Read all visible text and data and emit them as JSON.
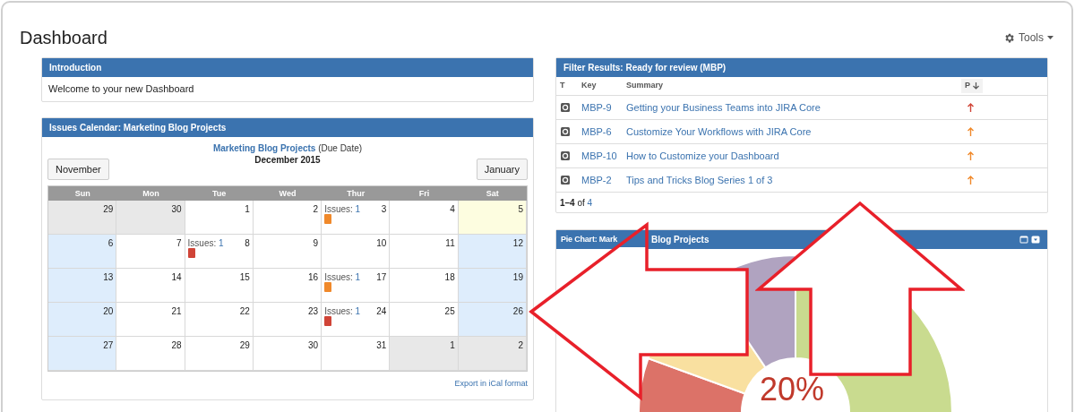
{
  "page": {
    "title": "Dashboard",
    "tools": "Tools"
  },
  "introduction": {
    "title": "Introduction",
    "text": "Welcome to your new Dashboard"
  },
  "calendar": {
    "title": "Issues Calendar: Marketing Blog Projects",
    "project": "Marketing Blog Projects",
    "field": "(Due Date)",
    "month": "December 2015",
    "prev": "November",
    "next": "January",
    "weekdays": [
      "Sun",
      "Mon",
      "Tue",
      "Wed",
      "Thur",
      "Fri",
      "Sat"
    ],
    "weeks": [
      [
        {
          "day": "29",
          "kind": "other"
        },
        {
          "day": "30",
          "kind": "other"
        },
        {
          "day": "1",
          "kind": "normal"
        },
        {
          "day": "2",
          "kind": "normal"
        },
        {
          "day": "3",
          "kind": "normal",
          "issues": {
            "label": "Issues:",
            "count": "1",
            "color": "#f0892b"
          }
        },
        {
          "day": "4",
          "kind": "normal"
        },
        {
          "day": "5",
          "kind": "today"
        }
      ],
      [
        {
          "day": "6",
          "kind": "weekend"
        },
        {
          "day": "7",
          "kind": "normal"
        },
        {
          "day": "8",
          "kind": "normal",
          "issues": {
            "label": "Issues:",
            "count": "1",
            "color": "#d04437"
          }
        },
        {
          "day": "9",
          "kind": "normal"
        },
        {
          "day": "10",
          "kind": "normal"
        },
        {
          "day": "11",
          "kind": "normal"
        },
        {
          "day": "12",
          "kind": "weekend"
        }
      ],
      [
        {
          "day": "13",
          "kind": "weekend"
        },
        {
          "day": "14",
          "kind": "normal"
        },
        {
          "day": "15",
          "kind": "normal"
        },
        {
          "day": "16",
          "kind": "normal"
        },
        {
          "day": "17",
          "kind": "normal",
          "issues": {
            "label": "Issues:",
            "count": "1",
            "color": "#f0892b"
          }
        },
        {
          "day": "18",
          "kind": "normal"
        },
        {
          "day": "19",
          "kind": "weekend"
        }
      ],
      [
        {
          "day": "20",
          "kind": "weekend"
        },
        {
          "day": "21",
          "kind": "normal"
        },
        {
          "day": "22",
          "kind": "normal"
        },
        {
          "day": "23",
          "kind": "normal"
        },
        {
          "day": "24",
          "kind": "normal",
          "issues": {
            "label": "Issues:",
            "count": "1",
            "color": "#d04437"
          }
        },
        {
          "day": "25",
          "kind": "normal"
        },
        {
          "day": "26",
          "kind": "weekend"
        }
      ],
      [
        {
          "day": "27",
          "kind": "weekend"
        },
        {
          "day": "28",
          "kind": "normal"
        },
        {
          "day": "29",
          "kind": "normal"
        },
        {
          "day": "30",
          "kind": "normal"
        },
        {
          "day": "31",
          "kind": "normal"
        },
        {
          "day": "1",
          "kind": "other"
        },
        {
          "day": "2",
          "kind": "other"
        }
      ]
    ],
    "export": "Export in iCal format"
  },
  "filter": {
    "title": "Filter Results: Ready for review (MBP)",
    "columns": [
      "T",
      "Key",
      "Summary",
      "P"
    ],
    "rows": [
      {
        "key": "MBP-9",
        "summary": "Getting your Business Teams into JIRA Core",
        "color": "#d04437"
      },
      {
        "key": "MBP-6",
        "summary": "Customize Your Workflows with JIRA Core",
        "color": "#f0892b"
      },
      {
        "key": "MBP-10",
        "summary": "How to Customize your Dashboard",
        "color": "#f0892b"
      },
      {
        "key": "MBP-2",
        "summary": "Tips and Tricks Blog Series 1 of 3",
        "color": "#f0892b"
      }
    ],
    "range": "1–4",
    "of": "of",
    "total": "4"
  },
  "pie": {
    "title_parts": [
      "Pie Chart: Mark",
      "Blog Projects"
    ],
    "center_value": "20%"
  }
}
